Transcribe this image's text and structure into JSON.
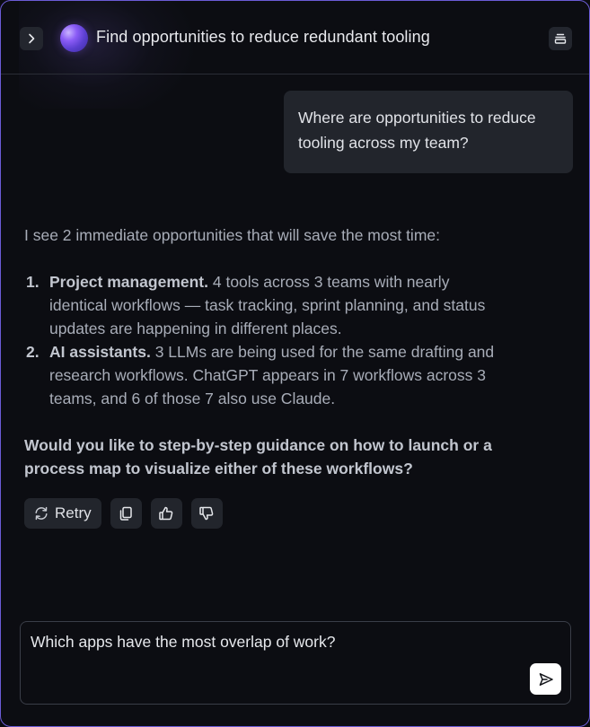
{
  "header": {
    "title": "Find opportunities to reduce redundant tooling",
    "expand_icon": "chevron-right-icon",
    "menu_icon": "stack-menu-icon"
  },
  "conversation": {
    "user_message": "Where are opportunities to reduce tooling across my team?",
    "assistant": {
      "intro": "I see 2 immediate opportunities that will save the most time:",
      "items": [
        {
          "num": "1.",
          "lead": "Project management.",
          "text": " 4 tools across 3 teams with nearly identical workflows — task tracking, sprint planning, and status updates are happening in different places."
        },
        {
          "num": "2.",
          "lead": "AI assistants.",
          "text": " 3 LLMs are being used for the same drafting and research workflows. ChatGPT appears in 7 workflows across 3 teams, and 6 of those 7 also use Claude."
        }
      ],
      "question": "Would you like to step-by-step guidance on how to launch or a process map to visualize either of these workflows?"
    },
    "actions": {
      "retry_label": "Retry",
      "retry_icon": "refresh-icon",
      "copy_icon": "copy-icon",
      "thumbs_up_icon": "thumbs-up-icon",
      "thumbs_down_icon": "thumbs-down-icon"
    }
  },
  "composer": {
    "value": "Which apps have the most overlap of work?",
    "send_icon": "send-icon"
  },
  "colors": {
    "background": "#0c0d12",
    "accent_border": "#6b5cd6",
    "bubble": "#22252c",
    "send_button": "#ffffff"
  }
}
